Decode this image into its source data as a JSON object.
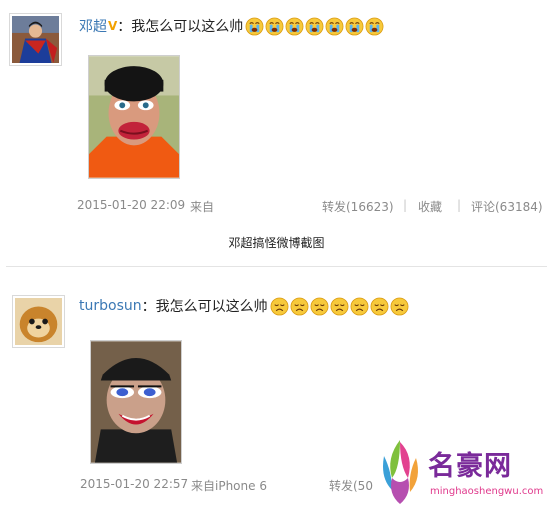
{
  "posts": [
    {
      "username": "邓超",
      "verified_badge": "V",
      "colon": "：",
      "text": "我怎么可以这么帅",
      "emoji_name": "crying-face",
      "emoji_count": 7,
      "timestamp": "2015-01-20 22:09",
      "source": "来自",
      "repost": "转发(16623)",
      "favorite": "收藏",
      "comment": "评论(63184)"
    },
    {
      "username": "turbosun",
      "colon": "：",
      "text": "我怎么可以这么帅",
      "emoji_name": "sad-face",
      "emoji_count": 7,
      "timestamp": "2015-01-20 22:57",
      "source": "来自iPhone 6",
      "repost": "转发(50"
    }
  ],
  "caption": "邓超搞怪微博截图",
  "watermark": {
    "name": "名豪网",
    "url": "minghaoshengwu.com"
  },
  "colors": {
    "username": "#3b78b4",
    "meta": "#8a8a8a",
    "badge": "#f2a100",
    "logo": "#7a2a9a"
  }
}
